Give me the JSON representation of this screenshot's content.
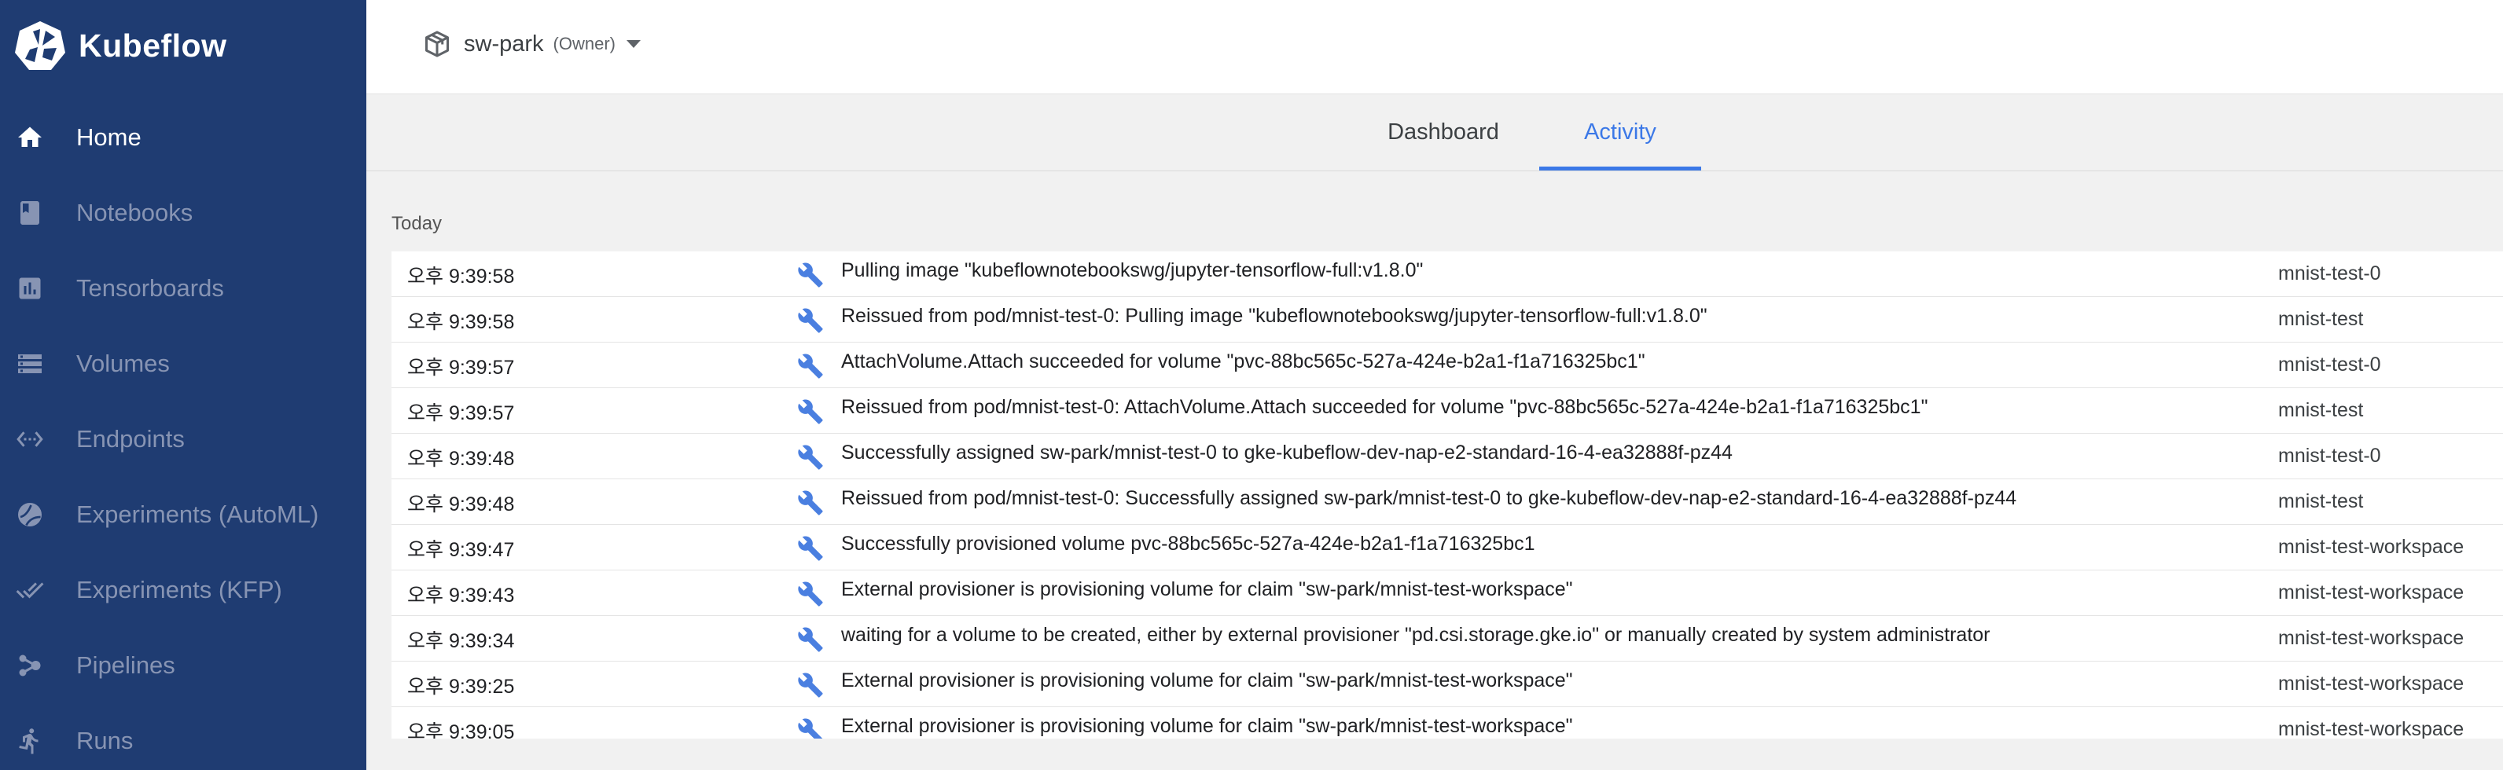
{
  "app": {
    "brand": "Kubeflow"
  },
  "sidebar": {
    "items": [
      {
        "label": "Home",
        "icon": "home-icon",
        "active": true
      },
      {
        "label": "Notebooks",
        "icon": "book-icon"
      },
      {
        "label": "Tensorboards",
        "icon": "assessment-icon"
      },
      {
        "label": "Volumes",
        "icon": "storage-icon"
      },
      {
        "label": "Endpoints",
        "icon": "settings-ethernet-icon"
      },
      {
        "label": "Experiments (AutoML)",
        "icon": "bubble-chart-icon"
      },
      {
        "label": "Experiments (KFP)",
        "icon": "done-all-icon"
      },
      {
        "label": "Pipelines",
        "icon": "device-hub-icon"
      },
      {
        "label": "Runs",
        "icon": "run-icon"
      }
    ]
  },
  "namespace": {
    "name": "sw-park",
    "role": "(Owner)"
  },
  "tabs": [
    {
      "label": "Dashboard",
      "active": false
    },
    {
      "label": "Activity",
      "active": true
    }
  ],
  "activity": {
    "section_label": "Today",
    "rows": [
      {
        "time": "오후 9:39:58",
        "message": "Pulling image \"kubeflownotebookswg/jupyter-tensorflow-full:v1.8.0\"",
        "name": "mnist-test-0"
      },
      {
        "time": "오후 9:39:58",
        "message": "Reissued from pod/mnist-test-0: Pulling image \"kubeflownotebookswg/jupyter-tensorflow-full:v1.8.0\"",
        "name": "mnist-test"
      },
      {
        "time": "오후 9:39:57",
        "message": "AttachVolume.Attach succeeded for volume \"pvc-88bc565c-527a-424e-b2a1-f1a716325bc1\"",
        "name": "mnist-test-0"
      },
      {
        "time": "오후 9:39:57",
        "message": "Reissued from pod/mnist-test-0: AttachVolume.Attach succeeded for volume \"pvc-88bc565c-527a-424e-b2a1-f1a716325bc1\"",
        "name": "mnist-test"
      },
      {
        "time": "오후 9:39:48",
        "message": "Successfully assigned sw-park/mnist-test-0 to gke-kubeflow-dev-nap-e2-standard-16-4-ea32888f-pz44",
        "name": "mnist-test-0"
      },
      {
        "time": "오후 9:39:48",
        "message": "Reissued from pod/mnist-test-0: Successfully assigned sw-park/mnist-test-0 to gke-kubeflow-dev-nap-e2-standard-16-4-ea32888f-pz44",
        "name": "mnist-test"
      },
      {
        "time": "오후 9:39:47",
        "message": "Successfully provisioned volume pvc-88bc565c-527a-424e-b2a1-f1a716325bc1",
        "name": "mnist-test-workspace"
      },
      {
        "time": "오후 9:39:43",
        "message": "External provisioner is provisioning volume for claim \"sw-park/mnist-test-workspace\"",
        "name": "mnist-test-workspace"
      },
      {
        "time": "오후 9:39:34",
        "message": "waiting for a volume to be created, either by external provisioner \"pd.csi.storage.gke.io\" or manually created by system administrator",
        "name": "mnist-test-workspace"
      },
      {
        "time": "오후 9:39:25",
        "message": "External provisioner is provisioning volume for claim \"sw-park/mnist-test-workspace\"",
        "name": "mnist-test-workspace"
      },
      {
        "time": "오후 9:39:05",
        "message": "External provisioner is provisioning volume for claim \"sw-park/mnist-test-workspace\"",
        "name": "mnist-test-workspace"
      }
    ]
  },
  "colors": {
    "sidebar_bg": "#1f3c72",
    "accent": "#3b78e7",
    "event_icon": "#4a7fe0"
  }
}
